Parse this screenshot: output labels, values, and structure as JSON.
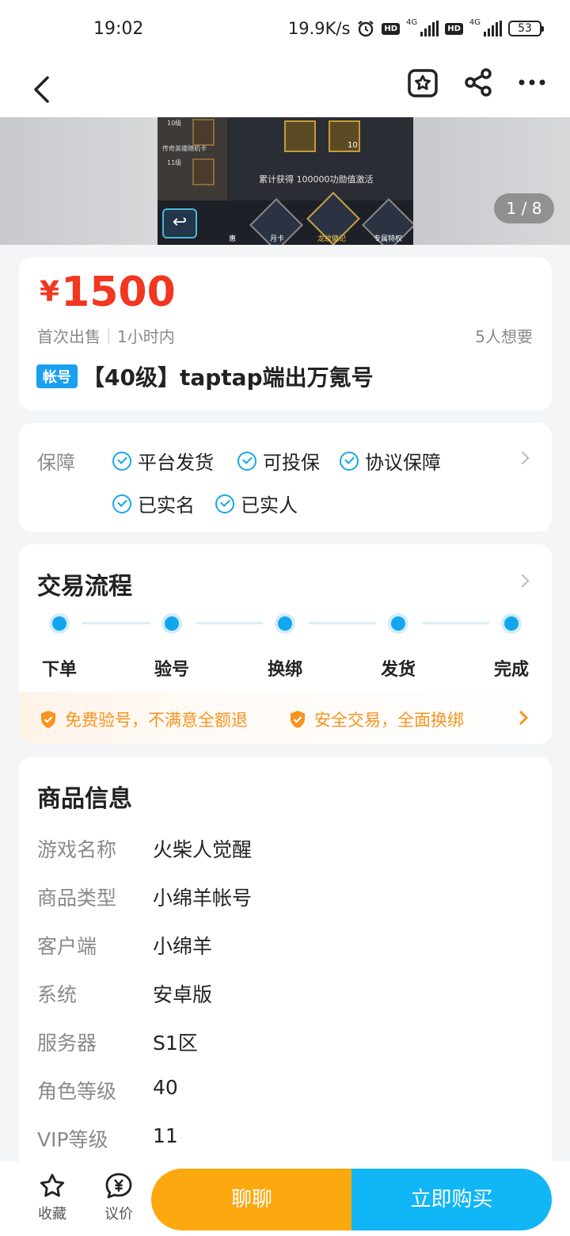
{
  "status_bar": {
    "time": "19:02",
    "speed": "19.9K/s",
    "hd1": "HD",
    "net1": "4G",
    "hd2": "HD",
    "net2": "4G",
    "battery": "53"
  },
  "banner": {
    "counter": "1 / 8",
    "img_level10": "10级",
    "img_level11": "11级",
    "img_card_label": "传奇英雄随机卡",
    "img_accum_text": "累计获得 100000功勋值激活",
    "img_count": "10",
    "img_labels": [
      "惠",
      "月卡",
      "龙纹徽记",
      "专属特权"
    ]
  },
  "price_card": {
    "currency": "¥",
    "price": "1500",
    "sale_type": "首次出售",
    "time": "1小时内",
    "wants": "5人想要",
    "tag": "帐号",
    "title": "【40级】taptap端出万氪号"
  },
  "guarantee": {
    "label": "保障",
    "items": [
      "平台发货",
      "可投保",
      "协议保障",
      "已实名",
      "已实人"
    ]
  },
  "flow": {
    "title": "交易流程",
    "steps": [
      "下单",
      "验号",
      "换绑",
      "发货",
      "完成"
    ],
    "notice": [
      "免费验号，不满意全额退",
      "安全交易，全面换绑"
    ]
  },
  "info": {
    "title": "商品信息",
    "rows": [
      {
        "key": "游戏名称",
        "value": "火柴人觉醒"
      },
      {
        "key": "商品类型",
        "value": "小绵羊帐号"
      },
      {
        "key": "客户端",
        "value": "小绵羊"
      },
      {
        "key": "系统",
        "value": "安卓版"
      },
      {
        "key": "服务器",
        "value": "S1区"
      },
      {
        "key": "角色等级",
        "value": "40"
      },
      {
        "key": "VIP等级",
        "value": "11"
      }
    ]
  },
  "bottom_bar": {
    "favorite": "收藏",
    "bargain": "议价",
    "chat": "聊聊",
    "buy": "立即购买"
  },
  "colors": {
    "accent_blue": "#10b6f6",
    "price_red": "#f2361f",
    "chat_orange": "#fca80f",
    "notice_orange": "#f7931e"
  }
}
